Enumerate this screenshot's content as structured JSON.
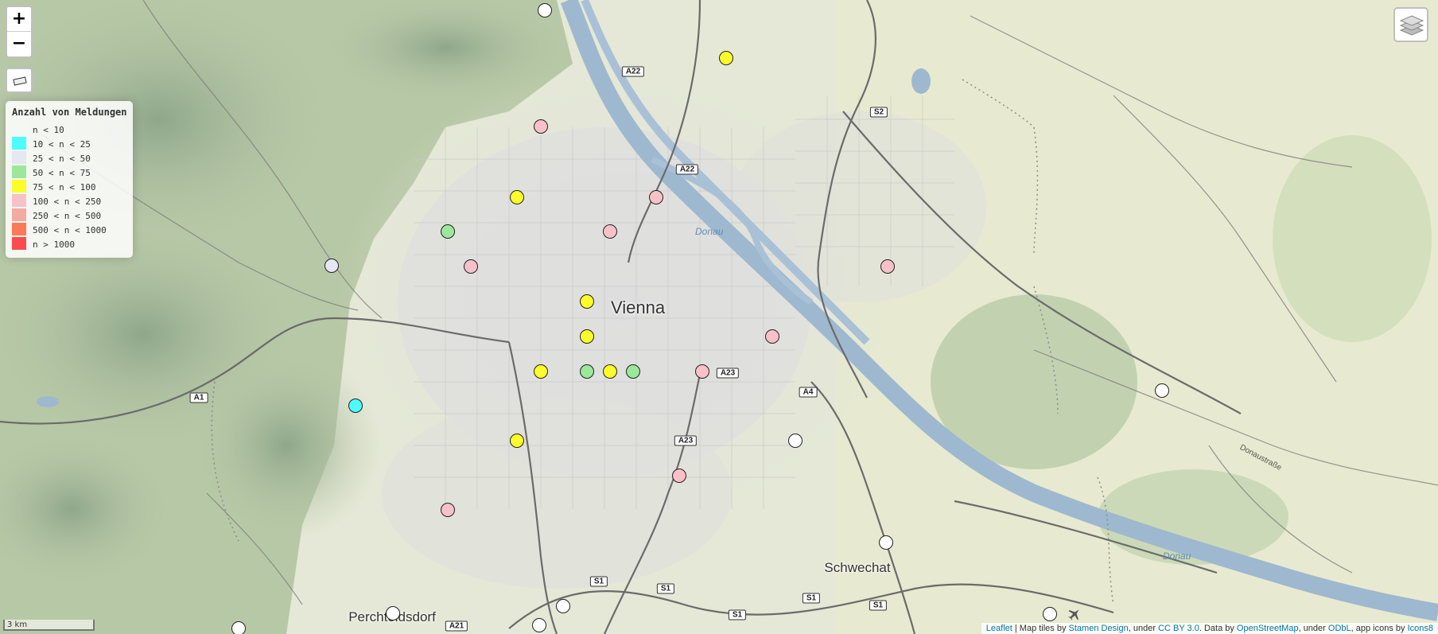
{
  "colors": {
    "bin_0": "#ffffff",
    "bin_1": "#4dfcfc",
    "bin_2": "#e6e6f5",
    "bin_3": "#9be89b",
    "bin_4": "#fcfc2a",
    "bin_5": "#f8c0c8",
    "bin_6": "#f4aaa0",
    "bin_7": "#fc7a58",
    "bin_8": "#fa4c4c"
  },
  "zoom": {
    "in_label": "+",
    "out_label": "−"
  },
  "legend": {
    "title": "Anzahl von Meldungen",
    "items": [
      {
        "label": "n < 10",
        "color": ""
      },
      {
        "label": "10 < n < 25",
        "color": "#4dfcfc"
      },
      {
        "label": "25 < n < 50",
        "color": "#e6e6f5"
      },
      {
        "label": "50 < n < 75",
        "color": "#9be89b"
      },
      {
        "label": "75 < n < 100",
        "color": "#fcfc2a"
      },
      {
        "label": "100 < n < 250",
        "color": "#f8c0c8"
      },
      {
        "label": "250 < n < 500",
        "color": "#f4aaa0"
      },
      {
        "label": "500 < n < 1000",
        "color": "#fc7a58"
      },
      {
        "label": "n > 1000",
        "color": "#fa4c4c"
      }
    ]
  },
  "scale": {
    "label": "3 km"
  },
  "labels": {
    "city_vienna": "Vienna",
    "city_schwechat": "Schwechat",
    "city_perchtoldsdorf": "Perchtoldsdorf",
    "water_donau_1": "Donau",
    "water_donau_2": "Donau",
    "street_donaustrasse": "Donaustraße"
  },
  "road_shields": [
    "A22",
    "A22",
    "S2",
    "A23",
    "A4",
    "A23",
    "A1",
    "S1",
    "S1",
    "S1",
    "S1",
    "S1",
    "A21"
  ],
  "attribution": {
    "leaflet": "Leaflet",
    "t1": " | Map tiles by ",
    "stamen": "Stamen Design",
    "t2": ", under ",
    "ccby": "CC BY 3.0",
    "t3": ". Data by ",
    "osm": "OpenStreetMap",
    "t4": ", under ",
    "odbl": "ODbL",
    "t5": ", app icons by ",
    "icons8": "Icons8"
  },
  "markers": [
    {
      "bin": 0
    },
    {
      "bin": 4
    },
    {
      "bin": 5
    },
    {
      "bin": 4
    },
    {
      "bin": 5
    },
    {
      "bin": 3
    },
    {
      "bin": 5
    },
    {
      "bin": 5
    },
    {
      "bin": 2
    },
    {
      "bin": 5
    },
    {
      "bin": 4
    },
    {
      "bin": 4
    },
    {
      "bin": 5
    },
    {
      "bin": 4
    },
    {
      "bin": 3
    },
    {
      "bin": 4
    },
    {
      "bin": 3
    },
    {
      "bin": 5
    },
    {
      "bin": 1
    },
    {
      "bin": 0
    },
    {
      "bin": 4
    },
    {
      "bin": 0
    },
    {
      "bin": 5
    },
    {
      "bin": 5
    },
    {
      "bin": 0
    },
    {
      "bin": 0
    },
    {
      "bin": 0
    },
    {
      "bin": 0
    },
    {
      "bin": 0
    },
    {
      "bin": 0
    },
    {
      "bin": 0
    }
  ]
}
